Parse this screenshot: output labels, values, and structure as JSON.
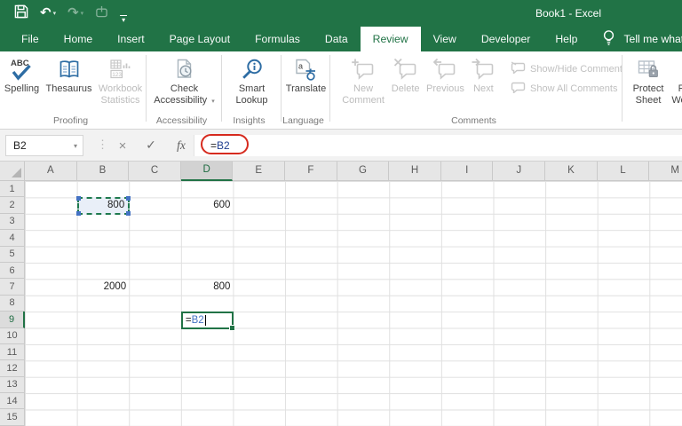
{
  "colors": {
    "excel_green": "#217346",
    "reference_blue": "#4472c4",
    "annotation_red": "#d62a1e",
    "reference_fill": "#e9eff8"
  },
  "title_bar": {
    "title": "Book1  -  Excel"
  },
  "qat": {
    "buttons": [
      {
        "name": "save",
        "icon": "save-icon",
        "enabled": true
      },
      {
        "name": "undo",
        "icon": "undo-icon",
        "enabled": true,
        "dropdown": true
      },
      {
        "name": "redo",
        "icon": "redo-icon",
        "enabled": false,
        "dropdown": true
      },
      {
        "name": "touch-mode",
        "icon": "touch-mode-icon",
        "enabled": false
      },
      {
        "name": "customize-quick-access-toolbar",
        "icon": "customize-qat-icon",
        "enabled": true
      }
    ]
  },
  "tabs": {
    "items": [
      {
        "label": "File"
      },
      {
        "label": "Home"
      },
      {
        "label": "Insert"
      },
      {
        "label": "Page Layout"
      },
      {
        "label": "Formulas"
      },
      {
        "label": "Data"
      },
      {
        "label": "Review",
        "active": true
      },
      {
        "label": "View"
      },
      {
        "label": "Developer"
      },
      {
        "label": "Help"
      }
    ],
    "tell_me": "Tell me what you want to do",
    "tell_me_icon": "lightbulb-icon"
  },
  "ribbon": {
    "groups": [
      {
        "name": "proofing",
        "label": "Proofing",
        "buttons": [
          {
            "label": "Spelling",
            "icon": "spelling-icon",
            "enabled": true
          },
          {
            "label": "Thesaurus",
            "icon": "thesaurus-icon",
            "enabled": true
          },
          {
            "label": "Workbook Statistics",
            "icon": "workbook-statistics-icon",
            "enabled": false
          }
        ]
      },
      {
        "name": "accessibility",
        "label": "Accessibility",
        "buttons": [
          {
            "label": "Check Accessibility",
            "icon": "check-accessibility-icon",
            "enabled": true,
            "dropdown": true
          }
        ]
      },
      {
        "name": "insights",
        "label": "Insights",
        "buttons": [
          {
            "label": "Smart Lookup",
            "icon": "smart-lookup-icon",
            "enabled": true
          }
        ]
      },
      {
        "name": "language",
        "label": "Language",
        "buttons": [
          {
            "label": "Translate",
            "icon": "translate-icon",
            "enabled": true
          }
        ]
      },
      {
        "name": "comments",
        "label": "Comments",
        "buttons": [
          {
            "label": "New Comment",
            "icon": "new-comment-icon",
            "enabled": false
          },
          {
            "label": "Delete",
            "icon": "delete-comment-icon",
            "enabled": false
          },
          {
            "label": "Previous",
            "icon": "previous-comment-icon",
            "enabled": false
          },
          {
            "label": "Next",
            "icon": "next-comment-icon",
            "enabled": false
          }
        ],
        "small_buttons": [
          {
            "label": "Show/Hide Comment",
            "icon": "show-hide-comment-icon",
            "enabled": false
          },
          {
            "label": "Show All Comments",
            "icon": "show-all-comments-icon",
            "enabled": false
          }
        ]
      },
      {
        "name": "protect",
        "label": "",
        "buttons": [
          {
            "label": "Protect Sheet",
            "icon": "protect-sheet-icon",
            "enabled": true
          },
          {
            "label": "Protect Workbook",
            "icon": "protect-workbook-icon",
            "enabled": true
          }
        ]
      }
    ]
  },
  "formula_bar": {
    "name_box_value": "B2",
    "cancel": "×",
    "enter": "✓",
    "insert_function": "fx",
    "formula_prefix": "=",
    "formula_reference": "B2",
    "annotation": "red-oval-around-formula"
  },
  "grid": {
    "column_headers": [
      "A",
      "B",
      "C",
      "D",
      "E",
      "F",
      "G",
      "H",
      "I",
      "J",
      "K",
      "L",
      "M"
    ],
    "row_count": 15,
    "active_column": "D",
    "active_row": 9,
    "cells": [
      {
        "ref": "B2",
        "value": "800",
        "highlight": "formula-reference"
      },
      {
        "ref": "D2",
        "value": "600"
      },
      {
        "ref": "B7",
        "value": "2000"
      },
      {
        "ref": "D7",
        "value": "800"
      }
    ],
    "editing_cell": {
      "ref": "D9",
      "prefix": "=",
      "reference": "B2"
    }
  }
}
